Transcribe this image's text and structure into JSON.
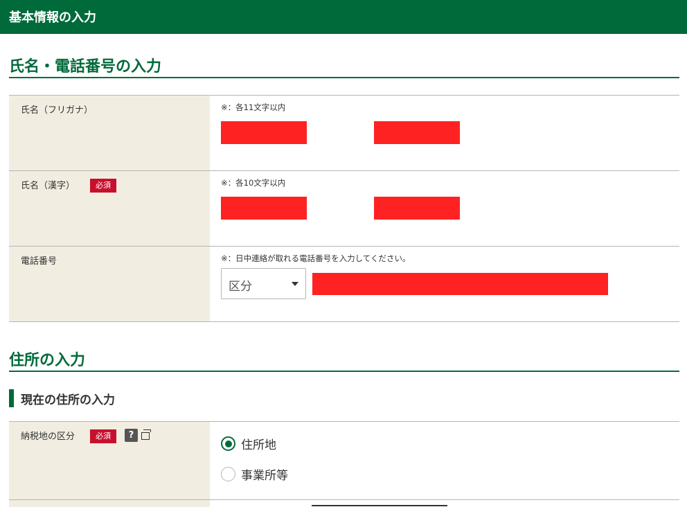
{
  "header": {
    "title": "基本情報の入力"
  },
  "name_phone_section": {
    "heading": "氏名・電話番号の入力",
    "rows": {
      "kana": {
        "label": "氏名（フリガナ）",
        "note": "※：各11文字以内"
      },
      "kanji": {
        "label": "氏名（漢字）",
        "required": "必須",
        "note": "※：各10文字以内"
      },
      "phone": {
        "label": "電話番号",
        "note": "※：日中連絡が取れる電話番号を入力してください。",
        "select_value": "区分"
      }
    }
  },
  "address_section": {
    "heading": "住所の入力",
    "subheading": "現在の住所の入力",
    "tax_place": {
      "label": "納税地の区分",
      "required": "必須",
      "help_icon": "?",
      "options": [
        "住所地",
        "事業所等"
      ],
      "selected": "住所地"
    }
  },
  "colors": {
    "brand_green": "#006a3a",
    "label_bg": "#f1ede1",
    "required_red": "#c8102e",
    "redaction": "#ff2222"
  }
}
